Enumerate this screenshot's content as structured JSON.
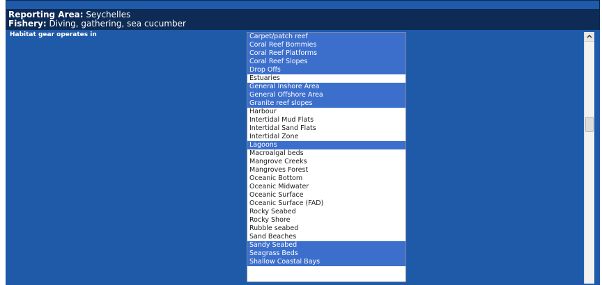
{
  "header": {
    "reporting_area_label": "Reporting Area:",
    "reporting_area_value": "Seychelles",
    "fishery_label": "Fishery:",
    "fishery_value": "Diving, gathering, sea cucumber"
  },
  "form": {
    "habitat_label": "Habitat gear operates in",
    "habitat_options": [
      {
        "label": "Carpet/patch reef",
        "selected": true
      },
      {
        "label": "Coral Reef Bommies",
        "selected": true
      },
      {
        "label": "Coral Reef Platforms",
        "selected": true
      },
      {
        "label": "Coral Reef Slopes",
        "selected": true
      },
      {
        "label": "Drop Offs",
        "selected": true
      },
      {
        "label": "Estuaries",
        "selected": false
      },
      {
        "label": "General Inshore Area",
        "selected": true
      },
      {
        "label": "General Offshore Area",
        "selected": true
      },
      {
        "label": "Granite reef slopes",
        "selected": true
      },
      {
        "label": "Harbour",
        "selected": false
      },
      {
        "label": "Intertidal Mud Flats",
        "selected": false
      },
      {
        "label": "Intertidal Sand Flats",
        "selected": false
      },
      {
        "label": "Intertidal Zone",
        "selected": false
      },
      {
        "label": "Lagoons",
        "selected": true
      },
      {
        "label": "Macroalgal beds",
        "selected": false
      },
      {
        "label": "Mangrove Creeks",
        "selected": false
      },
      {
        "label": "Mangroves Forest",
        "selected": false
      },
      {
        "label": "Oceanic Bottom",
        "selected": false
      },
      {
        "label": "Oceanic Midwater",
        "selected": false
      },
      {
        "label": "Oceanic Surface",
        "selected": false
      },
      {
        "label": "Oceanic Surface (FAD)",
        "selected": false
      },
      {
        "label": "Rocky Seabed",
        "selected": false
      },
      {
        "label": "Rocky Shore",
        "selected": false
      },
      {
        "label": "Rubble seabed",
        "selected": false
      },
      {
        "label": "Sand Beaches",
        "selected": false
      },
      {
        "label": "Sandy Seabed",
        "selected": true
      },
      {
        "label": "Seagrass Beds",
        "selected": true
      },
      {
        "label": "Shallow Coastal Bays",
        "selected": true
      }
    ]
  },
  "scrollbar": {
    "up_icon": "chevron-up-icon",
    "position": 0.33
  },
  "colors": {
    "panel_bg": "#1f5aa8",
    "header_bg": "#0d2b55",
    "selection": "#3c6fcc"
  }
}
